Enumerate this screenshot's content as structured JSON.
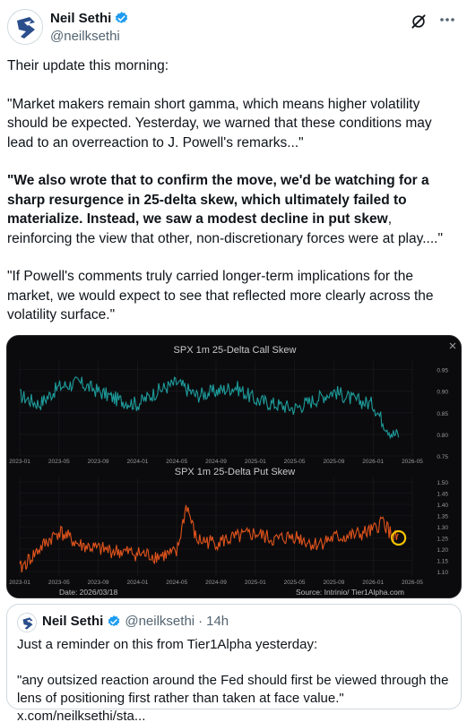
{
  "author": {
    "name": "Neil Sethi",
    "handle": "@neilksethi",
    "verified": true
  },
  "tweet": {
    "p1": "Their update this morning:",
    "p2": "\"Market makers remain short gamma, which means higher volatility should be expected. Yesterday, we warned that these conditions may lead to an overreaction to J. Powell's remarks...\"",
    "p3_bold": "\"We also wrote that to confirm the move, we'd be watching for a sharp resurgence in 25-delta skew, which ultimately failed to materialize. Instead, we saw a modest decline in put skew",
    "p3_rest": ", reinforcing the view that other, non-discretionary forces were at play....\"",
    "p4": "\"If Powell's comments truly carried longer-term implications for the market, we would expect to see that reflected more clearly across the volatility surface.\""
  },
  "chart_data": [
    {
      "type": "line",
      "title": "SPX 1m 25-Delta Call Skew",
      "x_ticks": [
        "2023-01",
        "2023-05",
        "2023-09",
        "2024-01",
        "2024-05",
        "2024-09",
        "2025-01",
        "2025-05",
        "2025-09",
        "2026-01",
        "2026-05"
      ],
      "y_ticks": [
        "0.95",
        "0.90",
        "0.85",
        "0.80",
        "0.75"
      ],
      "ylim": [
        0.75,
        0.97
      ],
      "color": "#1e9c9c",
      "series": [
        {
          "x": [
            "2023-01",
            "2023-03",
            "2023-05",
            "2023-07",
            "2023-09",
            "2023-11",
            "2024-01",
            "2024-03",
            "2024-05",
            "2024-07",
            "2024-09",
            "2024-11",
            "2025-01",
            "2025-03",
            "2025-05",
            "2025-07",
            "2025-09",
            "2025-11",
            "2026-01",
            "2026-02",
            "2026-03"
          ],
          "values": [
            0.89,
            0.87,
            0.91,
            0.92,
            0.9,
            0.88,
            0.87,
            0.9,
            0.92,
            0.89,
            0.9,
            0.91,
            0.88,
            0.87,
            0.86,
            0.88,
            0.9,
            0.88,
            0.87,
            0.83,
            0.8
          ]
        }
      ]
    },
    {
      "type": "line",
      "title": "SPX 1m 25-Delta Put Skew",
      "x_ticks": [
        "2023-01",
        "2023-05",
        "2023-09",
        "2024-01",
        "2024-05",
        "2024-09",
        "2025-01",
        "2025-05",
        "2025-09",
        "2026-01",
        "2026-05"
      ],
      "y_ticks": [
        "1.50",
        "1.45",
        "1.40",
        "1.35",
        "1.30",
        "1.25",
        "1.20",
        "1.15",
        "1.10"
      ],
      "ylim": [
        1.08,
        1.52
      ],
      "color": "#e0531c",
      "series": [
        {
          "x": [
            "2023-01",
            "2023-03",
            "2023-05",
            "2023-07",
            "2023-09",
            "2023-11",
            "2024-01",
            "2024-03",
            "2024-05",
            "2024-06",
            "2024-07",
            "2024-09",
            "2024-11",
            "2025-01",
            "2025-03",
            "2025-05",
            "2025-07",
            "2025-09",
            "2025-11",
            "2026-01",
            "2026-02",
            "2026-03"
          ],
          "values": [
            1.11,
            1.2,
            1.28,
            1.22,
            1.2,
            1.19,
            1.18,
            1.17,
            1.18,
            1.4,
            1.24,
            1.23,
            1.25,
            1.27,
            1.24,
            1.26,
            1.22,
            1.25,
            1.26,
            1.28,
            1.33,
            1.25
          ]
        }
      ]
    }
  ],
  "chart_footer": {
    "date": "Date: 2026/03/18",
    "source": "Source: Intrinio/ Tier1Alpha.com"
  },
  "quote": {
    "name": "Neil Sethi",
    "handle": "@neilksethi",
    "time": "14h",
    "p1": "Just a reminder on this from Tier1Alpha yesterday:",
    "p2": "\"any outsized reaction around the Fed should first be viewed through the lens of positioning first rather than taken at face value.\" x.com/neilksethi/sta..."
  },
  "icons": [
    "avatar-logo-icon",
    "verified-badge-icon",
    "grok-icon",
    "more-options-icon",
    "close-chart-icon",
    "highlight-circle-icon"
  ]
}
